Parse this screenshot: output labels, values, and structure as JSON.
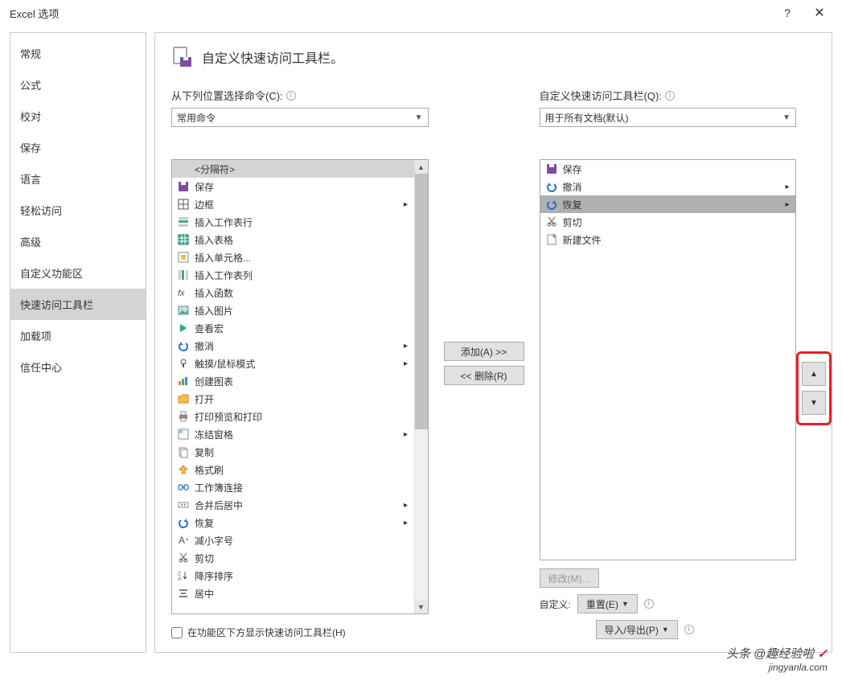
{
  "titlebar": {
    "title": "Excel 选项",
    "help": "?",
    "close": "✕"
  },
  "sidebar": {
    "items": [
      {
        "label": "常规"
      },
      {
        "label": "公式"
      },
      {
        "label": "校对"
      },
      {
        "label": "保存"
      },
      {
        "label": "语言"
      },
      {
        "label": "轻松访问"
      },
      {
        "label": "高级"
      },
      {
        "label": "自定义功能区"
      },
      {
        "label": "快速访问工具栏",
        "selected": true
      },
      {
        "label": "加载项"
      },
      {
        "label": "信任中心"
      }
    ]
  },
  "header": {
    "title": "自定义快速访问工具栏。"
  },
  "left": {
    "label": "从下列位置选择命令(C):",
    "dropdown": "常用命令",
    "separator_label": "<分隔符>",
    "items": [
      {
        "icon": "save",
        "label": "保存"
      },
      {
        "icon": "border",
        "label": "边框",
        "sub": true
      },
      {
        "icon": "insert-row",
        "label": "插入工作表行"
      },
      {
        "icon": "insert-table",
        "label": "插入表格"
      },
      {
        "icon": "insert-cells",
        "label": "插入单元格..."
      },
      {
        "icon": "insert-col",
        "label": "插入工作表列"
      },
      {
        "icon": "fx",
        "label": "插入函数"
      },
      {
        "icon": "insert-pic",
        "label": "插入图片"
      },
      {
        "icon": "macro",
        "label": "查看宏"
      },
      {
        "icon": "undo",
        "label": "撤消",
        "sub": true
      },
      {
        "icon": "touch",
        "label": "触摸/鼠标模式",
        "sub": true
      },
      {
        "icon": "chart",
        "label": "创建图表"
      },
      {
        "icon": "open",
        "label": "打开"
      },
      {
        "icon": "print",
        "label": "打印预览和打印"
      },
      {
        "icon": "freeze",
        "label": "冻结窗格",
        "sub": true
      },
      {
        "icon": "copy",
        "label": "复制"
      },
      {
        "icon": "format-painter",
        "label": "格式刷"
      },
      {
        "icon": "link",
        "label": "工作簿连接"
      },
      {
        "icon": "merge",
        "label": "合并后居中",
        "sub": true
      },
      {
        "icon": "redo",
        "label": "恢复",
        "sub": true
      },
      {
        "icon": "font-dec",
        "label": "减小字号"
      },
      {
        "icon": "cut",
        "label": "剪切"
      },
      {
        "icon": "sort-desc",
        "label": "降序排序"
      },
      {
        "icon": "center",
        "label": "居中"
      }
    ]
  },
  "right": {
    "label": "自定义快速访问工具栏(Q):",
    "dropdown": "用于所有文档(默认)",
    "items": [
      {
        "icon": "save",
        "label": "保存"
      },
      {
        "icon": "undo",
        "label": "撤消",
        "sub": true
      },
      {
        "icon": "redo",
        "label": "恢复",
        "sub": true,
        "selected": true
      },
      {
        "icon": "cut",
        "label": "剪切"
      },
      {
        "icon": "newfile",
        "label": "新建文件"
      }
    ],
    "modify_btn": "修改(M)...",
    "customize_label": "自定义:",
    "reset_btn": "重置(E)",
    "importexport_btn": "导入/导出(P)"
  },
  "mid": {
    "add": "添加(A) >>",
    "remove": "<< 删除(R)"
  },
  "checkbox": {
    "label": "在功能区下方显示快速访问工具栏(H)"
  },
  "watermark": {
    "t1": "头条 @趣经验啦",
    "t2": "jingyanla.com"
  }
}
